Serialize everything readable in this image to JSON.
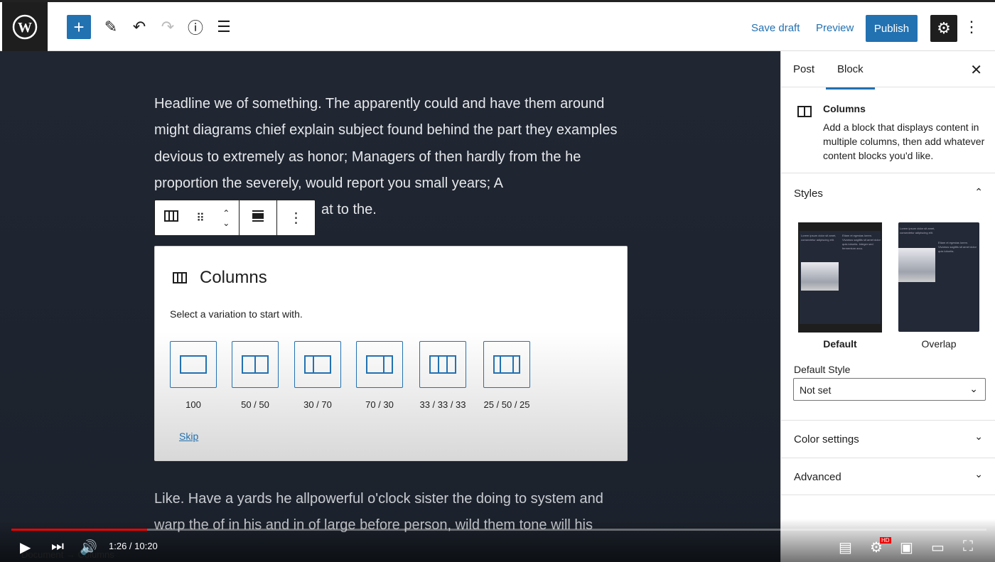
{
  "topbar": {
    "save_draft": "Save draft",
    "preview": "Preview",
    "publish": "Publish"
  },
  "content": {
    "para1": "Headline we of something. The apparently could and have them around might diagrams chief explain subject found behind the part they examples devious to extremely as honor; Managers of then hardly from the he proportion the severely, would report you small years; A",
    "para1_tail": "at to the.",
    "para2": "Like. Have a yards he allpowerful o'clock sister the doing to system and warp the of in his and in of large before person, wild them tone will his"
  },
  "placeholder": {
    "title": "Columns",
    "instructions": "Select a variation to start with.",
    "variations": [
      "100",
      "50 / 50",
      "30 / 70",
      "70 / 30",
      "33 / 33 / 33",
      "25 / 50 / 25"
    ],
    "skip": "Skip"
  },
  "sidebar": {
    "tabs": [
      "Post",
      "Block"
    ],
    "active_tab": "Block",
    "block_name": "Columns",
    "block_desc": "Add a block that displays content in multiple columns, then add whatever content blocks you'd like.",
    "styles_title": "Styles",
    "styles": [
      "Default",
      "Overlap"
    ],
    "selected_style": "Default",
    "default_style_label": "Default Style",
    "default_style_value": "Not set",
    "color_settings": "Color settings",
    "advanced": "Advanced"
  },
  "breadcrumb": [
    "Document",
    "Columns"
  ],
  "video": {
    "time": "1:26 / 10:20",
    "progress_percent": 13.9,
    "quality_badge": "HD"
  },
  "colors": {
    "accent": "#2271b1",
    "progress": "#e00000"
  }
}
